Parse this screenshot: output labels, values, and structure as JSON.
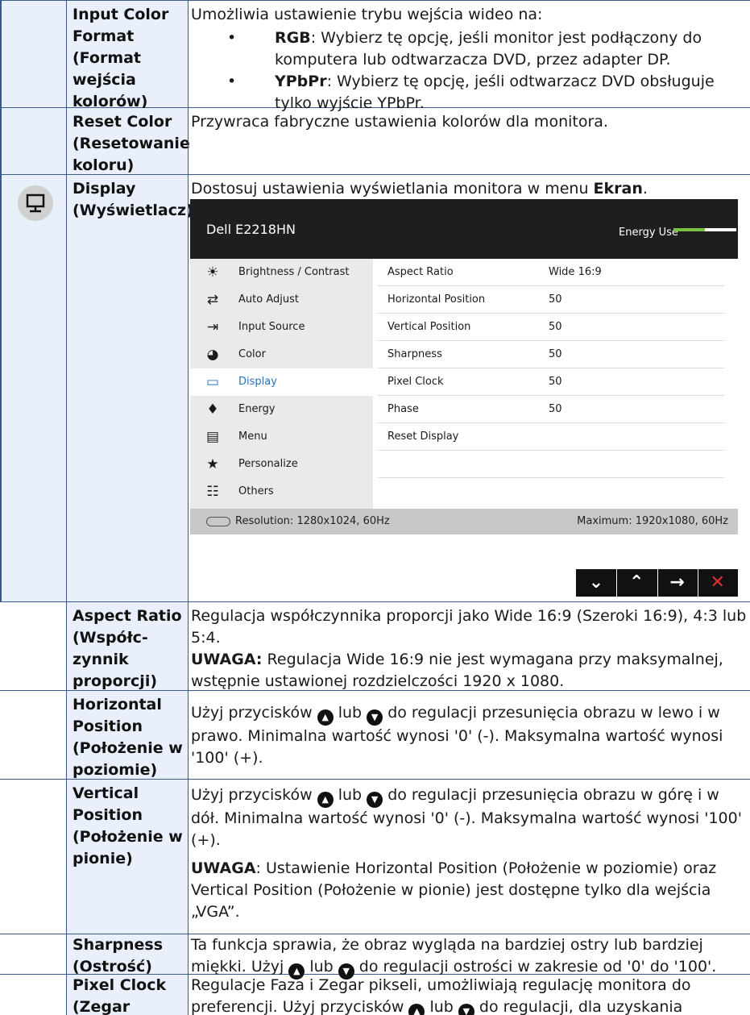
{
  "rows": {
    "input_color_format": {
      "label": [
        "Input Color",
        "Format",
        "(Format",
        "wejścia",
        "kolorów)"
      ],
      "intro": "Umożliwia ustawienie trybu wejścia wideo na:",
      "bullets": [
        {
          "bold": "RGB",
          "text": ": Wybierz tę opcję, jeśli monitor jest podłączony do komputera lub odtwarzacza DVD, przez adapter DP."
        },
        {
          "bold": "YPbPr",
          "text": ": Wybierz tę opcję, jeśli odtwarzacz DVD obsługuje tylko wyjście YPbPr."
        }
      ]
    },
    "reset_color": {
      "label": [
        "Reset Color",
        "(Resetowanie",
        "koloru)"
      ],
      "desc": "Przywraca fabryczne ustawienia kolorów dla monitora."
    },
    "display": {
      "label": [
        "Display",
        "(Wyświetlacz)"
      ],
      "desc_pre": "Dostosuj ustawienia wyświetlania monitora w menu ",
      "desc_bold": "Ekran",
      "desc_post": "."
    },
    "aspect_ratio": {
      "label": [
        "Aspect Ratio",
        "(Współc-",
        "zynnik",
        "proporcji)"
      ],
      "desc": "Regulacja współczynnika proporcji jako Wide 16:9 (Szeroki 16:9), 4:3 lub 5:4.",
      "note_bold": "UWAGA:",
      "note": " Regulacja Wide 16:9 nie jest wymagana przy maksymalnej, wstępnie ustawionej rozdzielczości 1920 x 1080."
    },
    "horizontal_position": {
      "label": [
        "Horizontal",
        "Position",
        "(Położenie w",
        "poziomie)"
      ],
      "desc_a": "Użyj przycisków ",
      "desc_b": " lub ",
      "desc_c": " do regulacji przesunięcia obrazu w lewo i w prawo. Minimalna wartość wynosi '0' (-). Maksymalna wartość wynosi '100' (+)."
    },
    "vertical_position": {
      "label": [
        "Vertical",
        "Position",
        "(Położenie w",
        "pionie)"
      ],
      "desc_a": " Użyj przycisków ",
      "desc_b": " lub ",
      "desc_c": " do regulacji przesunięcia obrazu w górę i w dół. Minimalna wartość wynosi '0' (-). Maksymalna wartość wynosi '100' (+).",
      "note_bold": "UWAGA",
      "note": ": Ustawienie Horizontal Position (Położenie w poziomie) oraz Vertical Position (Położenie w pionie) jest dostępne tylko dla wejścia „VGA”."
    },
    "sharpness": {
      "label": [
        "Sharpness",
        "(Ostrość)"
      ],
      "desc_a": "Ta funkcja sprawia, że obraz wygląda na bardziej ostry lub bardziej miękki. Użyj ",
      "desc_b": " lub ",
      "desc_c": " do regulacji ostrości w zakresie od '0' do '100'."
    },
    "pixel_clock": {
      "label": [
        "Pixel Clock",
        "(Zegar pikseli)"
      ],
      "desc_a": "Regulacje Faza i Zegar pikseli, umożliwiają regulację monitora do preferencji. Użyj przycisków ",
      "desc_b": " lub ",
      "desc_c": " do regulacji, dla uzyskania najlepszej jakości obrazu."
    }
  },
  "osd": {
    "title": "Dell E2218HN",
    "energy_label": "Energy Use",
    "energy_level": 0.5,
    "menu": [
      {
        "icon": "brightness-icon",
        "glyph": "☀",
        "label": "Brightness / Contrast"
      },
      {
        "icon": "auto-adjust-icon",
        "glyph": "⇄",
        "label": "Auto Adjust"
      },
      {
        "icon": "input-source-icon",
        "glyph": "⇥",
        "label": "Input Source"
      },
      {
        "icon": "color-icon",
        "glyph": "◕",
        "label": "Color"
      },
      {
        "icon": "display-icon",
        "glyph": "▭",
        "label": "Display"
      },
      {
        "icon": "energy-icon",
        "glyph": "♦",
        "label": "Energy"
      },
      {
        "icon": "menu-icon",
        "glyph": "▤",
        "label": "Menu"
      },
      {
        "icon": "star-icon",
        "glyph": "★",
        "label": "Personalize"
      },
      {
        "icon": "others-icon",
        "glyph": "☷",
        "label": "Others"
      }
    ],
    "selected_menu": "Display",
    "settings": [
      {
        "key": "Aspect Ratio",
        "value": "Wide 16:9"
      },
      {
        "key": "Horizontal Position",
        "value": "50"
      },
      {
        "key": "Vertical Position",
        "value": "50"
      },
      {
        "key": "Sharpness",
        "value": "50"
      },
      {
        "key": "Pixel Clock",
        "value": "50"
      },
      {
        "key": "Phase",
        "value": "50"
      },
      {
        "key": "Reset Display",
        "value": ""
      },
      {
        "key": "",
        "value": ""
      }
    ],
    "resolution": "Resolution: 1280x1024, 60Hz",
    "maximum": "Maximum: 1920x1080, 60Hz",
    "buttons": [
      {
        "name": "down-button",
        "glyph": "⌄"
      },
      {
        "name": "up-button",
        "glyph": "⌃"
      },
      {
        "name": "enter-button",
        "glyph": "→"
      },
      {
        "name": "exit-button",
        "glyph": "✕"
      }
    ]
  },
  "colors": {
    "accent": "#2d6fc0",
    "energy_bar": "#7ac142",
    "label_bg": "#e9f0fb",
    "border": "#3a5a8a",
    "exit": "#e03030"
  }
}
